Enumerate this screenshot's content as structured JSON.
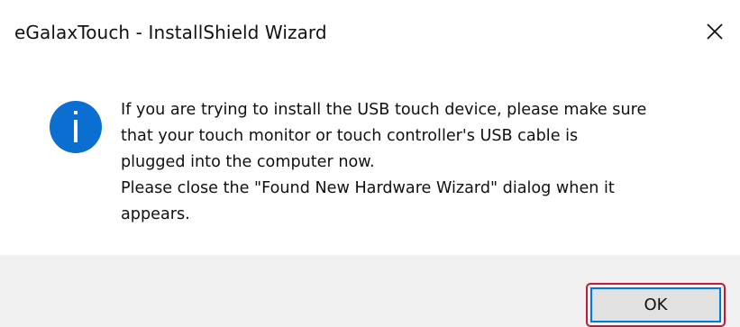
{
  "window": {
    "title": "eGalaxTouch - InstallShield Wizard",
    "close_icon": "close-icon"
  },
  "message": {
    "icon": "info-icon",
    "text": "If you are trying to install the USB touch device, please make sure\nthat your touch monitor or touch controller's USB cable is\nplugged into the computer now.\nPlease close the \"Found New Hardware Wizard\" dialog when it\nappears."
  },
  "buttons": {
    "ok_label": "OK"
  },
  "colors": {
    "info_icon": "#0a6fd0",
    "ok_highlight": "#c3193a",
    "ok_focus": "#0078d7",
    "footer_bg": "#f0f0f0"
  }
}
